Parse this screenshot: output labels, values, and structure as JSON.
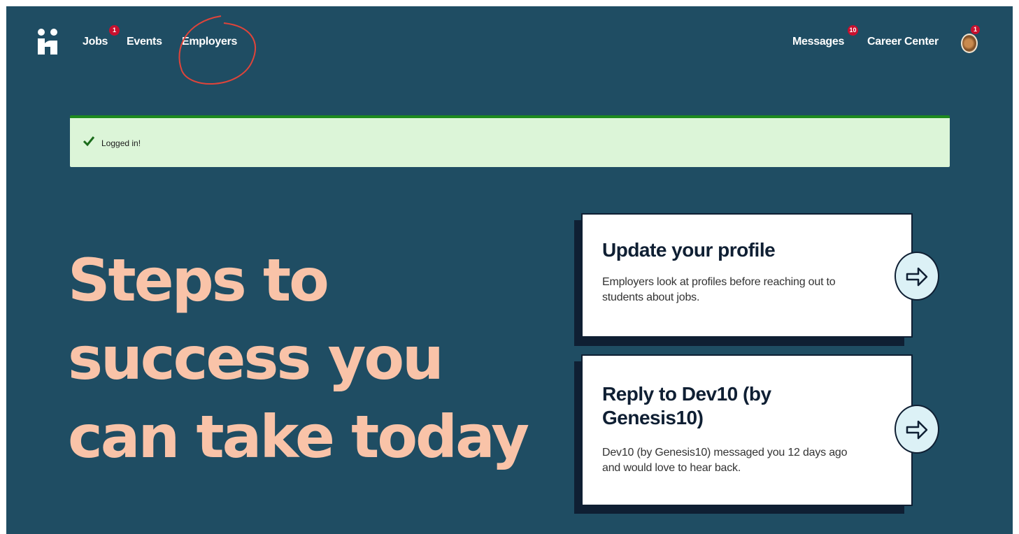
{
  "nav": {
    "jobs_label": "Jobs",
    "jobs_badge": "1",
    "events_label": "Events",
    "employers_label": "Employers",
    "messages_label": "Messages",
    "messages_badge": "10",
    "career_center_label": "Career Center",
    "avatar_badge": "1"
  },
  "alert": {
    "message": "Logged in!"
  },
  "hero": {
    "line1": "Steps to",
    "line2": "success you",
    "line3": "can take today"
  },
  "cards": [
    {
      "title_line1": "Update your profile",
      "title_line2": "",
      "desc_line1": "Employers look at profiles before reaching out to",
      "desc_line2": "students about jobs."
    },
    {
      "title_line1": "Reply to Dev10 (by",
      "title_line2": "Genesis10)",
      "desc_line1": "Dev10 (by Genesis10) messaged you 12 days ago",
      "desc_line2": "and would love to hear back."
    }
  ],
  "colors": {
    "background": "#1f4d63",
    "hero_text": "#f9c3a8",
    "alert_bg": "#dcf5d8",
    "badge": "#c8102e",
    "annotation": "#e0443a"
  }
}
